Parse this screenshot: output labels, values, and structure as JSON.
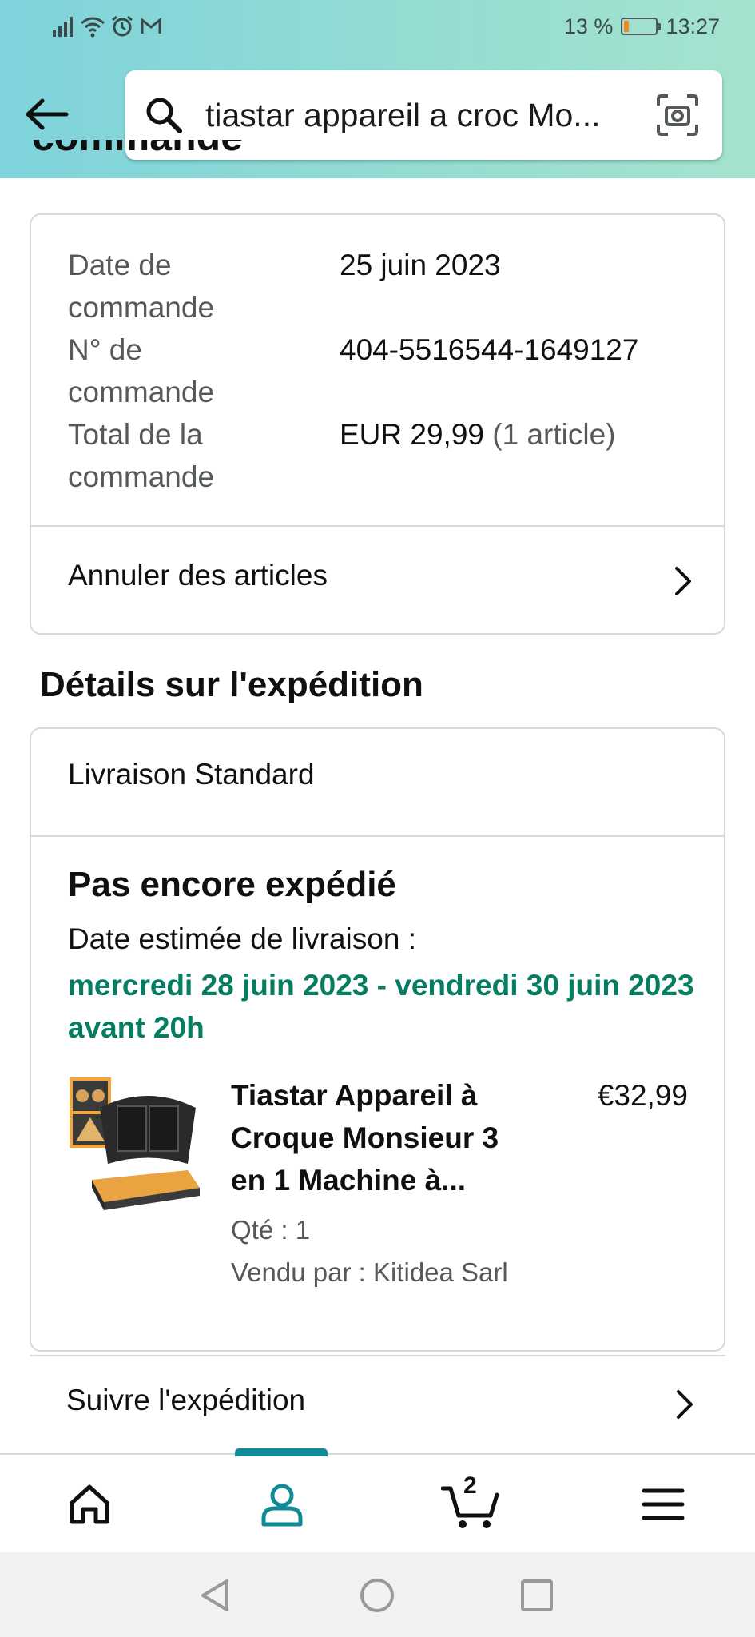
{
  "status_bar": {
    "battery_percent_label": "13 %",
    "battery_level": 0.13,
    "time": "13:27",
    "icons": [
      "signal-icon",
      "wifi-icon",
      "alarm-icon",
      "gmail-icon"
    ]
  },
  "search": {
    "query": "tiastar appareil a croc Mo..."
  },
  "cut_title": "commande",
  "order_summary": {
    "rows": [
      {
        "label": "Date de commande",
        "value": "25 juin 2023"
      },
      {
        "label": "N° de commande",
        "value": "404-5516544-1649127"
      },
      {
        "label": "Total de la commande",
        "value": "EUR 29,99",
        "value_suffix": "(1 article)"
      }
    ],
    "cancel_label": "Annuler des articles"
  },
  "shipping": {
    "section_title": "Détails sur l'expédition",
    "method": "Livraison Standard",
    "status": "Pas encore expédié",
    "estimate_label": "Date estimée de livraison :",
    "estimate_date": "mercredi 28 juin 2023 - vendredi 30 juin 2023 avant 20h",
    "product": {
      "title": "Tiastar Appareil à Croque Monsieur 3 en 1 Machine à...",
      "price": "€32,99",
      "qty": "Qté : 1",
      "seller": "Vendu par : Kitidea Sarl"
    },
    "track_label": "Suivre l'expédition"
  },
  "bottom_nav": {
    "cart_count": "2",
    "items": [
      "home-icon",
      "account-icon",
      "cart-icon",
      "menu-icon"
    ],
    "active": "account-icon"
  },
  "colors": {
    "accent": "#118a98",
    "delivery_green": "#067d62",
    "battery_orange": "#f08a1c"
  }
}
